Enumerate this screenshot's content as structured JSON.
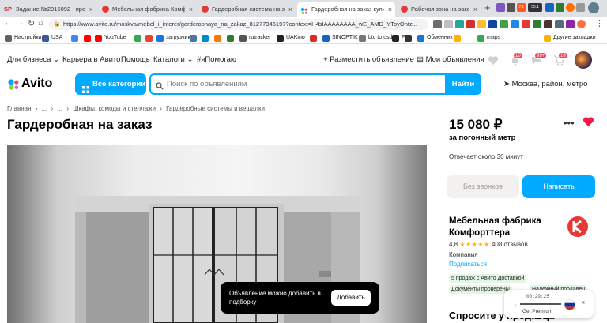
{
  "browser": {
    "tabs": [
      {
        "label": "Задание №2916092 - просмо",
        "fav": "sp",
        "color": "#c1272d"
      },
      {
        "label": "Мебельная фабрика Комфор",
        "fav": "circle",
        "color": "#e53935"
      },
      {
        "label": "Гардеробная система на зака",
        "fav": "circle",
        "color": "#e53935"
      },
      {
        "label": "Гардеробная на заказ купить",
        "fav": "avito",
        "color": "#0af"
      },
      {
        "label": "Рабочая зона на заказ купить",
        "fav": "circle",
        "color": "#e53935"
      }
    ],
    "tab_fav_sp": "SP",
    "tab_close": "×",
    "new_tab": "+",
    "url": "https://www.avito.ru/moskva/mebel_i_interer/garderobnaya_na_zakaz_812773461​97?context=H4sIAAAAAAAA_wE_AMD_YToyOntz...",
    "ext_badges": {
      "ya": "73",
      "ltc": "55.1"
    },
    "nav": {
      "back": "←",
      "forward": "→",
      "reload": "↻",
      "home": "⌂"
    }
  },
  "bookmarks": [
    {
      "label": "Настройки",
      "color": "#5f6368"
    },
    {
      "label": "USA",
      "color": "#3b5998"
    },
    {
      "label": "",
      "color": "#4285f4"
    },
    {
      "label": "",
      "color": "#ff0000"
    },
    {
      "label": "YouTube",
      "color": "#ff0000"
    },
    {
      "label": "",
      "color": "#34a853"
    },
    {
      "label": "",
      "color": "#ea4335"
    },
    {
      "label": "загрузчик",
      "color": "#1a73e8"
    },
    {
      "label": "",
      "color": "#4a76a8"
    },
    {
      "label": "",
      "color": "#0088cc"
    },
    {
      "label": "",
      "color": "#f57c00"
    },
    {
      "label": "",
      "color": "#2e7d32"
    },
    {
      "label": "rutracker",
      "color": "#555555"
    },
    {
      "label": "UAKino",
      "color": "#222222"
    },
    {
      "label": "",
      "color": "#d32f2f"
    },
    {
      "label": "SINOPTIK",
      "color": "#1565c0"
    },
    {
      "label": "btc to usd",
      "color": "#777777"
    },
    {
      "label": "FP",
      "color": "#222222"
    },
    {
      "label": "",
      "color": "#333333"
    },
    {
      "label": "Обменник",
      "color": "#1976d2"
    },
    {
      "label": "",
      "color": "#ffb300"
    },
    {
      "label": "maps",
      "color": "#34a853"
    },
    {
      "label": "Другие закладки",
      "color": "#f4b400"
    }
  ],
  "site": {
    "topnav": {
      "business": "Для бизнеса",
      "career": "Карьера в Авито",
      "help": "Помощь",
      "catalogs": "Каталоги",
      "ihelp": "#яПомогаю",
      "post_ad": "Разместить объявление",
      "my_ads": "Мои объявления",
      "badge_fav": "10",
      "badge_msg": "99+",
      "badge_cart": "16"
    },
    "logo": "Avito",
    "categories_button": "Все категории",
    "search_placeholder": "Поиск по объявлениям",
    "find_button": "Найти",
    "location": "Москва, район, метро",
    "breadcrumbs": [
      "Главная",
      "›",
      "...",
      "›",
      "...",
      "›",
      "Шкафы, комоды и стеллажи",
      "›",
      "Гардеробные системы и вешалки"
    ],
    "title": "Гардеробная на заказ",
    "price": "15 080 ₽",
    "price_unit": "за погонный метр",
    "reply_time": "Отвечает около 30 минут",
    "no_calls_button": "Без звонков",
    "write_button": "Написать",
    "seller": {
      "name": "Мебельная фабрика Комфорттера",
      "rating": "4,8",
      "stars": "★★★★★",
      "reviews": "408 отзывов",
      "type": "Компания",
      "subscribe": "Подписаться"
    },
    "chips": [
      "5 продаж с Авито Доставкой",
      "Документы проверены",
      "Надёжный продавец"
    ],
    "ask_seller": "Спросите у продавца",
    "toast": {
      "message": "Объявление можно добавить в подборку",
      "add_button": "Добавить"
    },
    "widget": {
      "time": "00:29:25",
      "label": "Get Premium",
      "close": "×"
    },
    "colors": {
      "accent": "#00aaff",
      "heart": "#ff1744",
      "badge": "#ff4053"
    }
  }
}
